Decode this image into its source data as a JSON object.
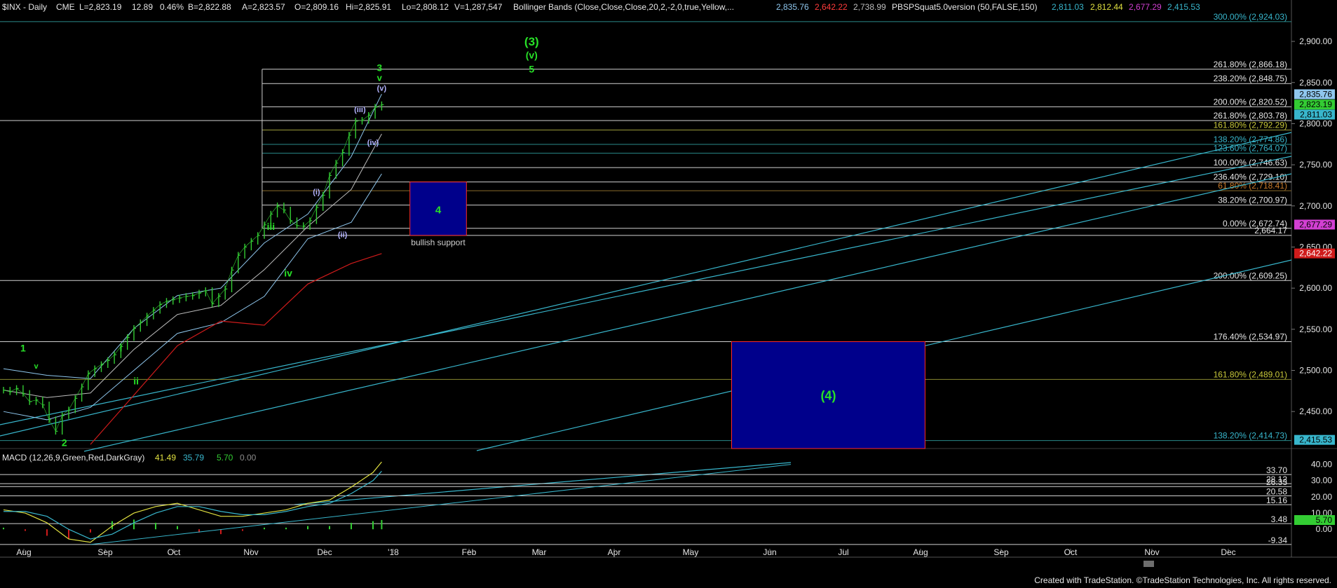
{
  "header": {
    "symbol": "$INX - Daily",
    "exchange": "CME",
    "last": "L=2,823.19",
    "change": "12.89",
    "change_pct": "0.46%",
    "bid": "B=2,822.88",
    "ask": "A=2,823.57",
    "open": "O=2,809.16",
    "high": "Hi=2,825.91",
    "low": "Lo=2,808.12",
    "volume": "V=1,287,547",
    "bb_label": "Bollinger Bands (Close,Close,Close,20,2,-2,0,true,Yellow,...",
    "bb_v1": "2,835.76",
    "bb_v2": "2,642.22",
    "bb_v3": "2,738.99",
    "pbs_label": "PBSPSquat5.0version (50,FALSE,150)",
    "pbs_v1": "2,811.03",
    "pbs_v2": "2,812.44",
    "pbs_v3": "2,677.29",
    "pbs_v4": "2,415.53"
  },
  "colors": {
    "background": "#000000",
    "price_bars": "#33cc33",
    "bb_band": "#8fc7ee",
    "midline": "#bdbdbd",
    "red_line": "#d01b1b",
    "trend": "#38b6cc",
    "wave_label": "#27e027",
    "subwave_label": "#b3b3ff",
    "box_fill": "#00008b",
    "box_border": "#ff2a2a"
  },
  "chart_data": {
    "type": "line",
    "title": "$INX - Daily",
    "x_months": [
      "Aug",
      "Sep",
      "Oct",
      "Nov",
      "Dec",
      "'18",
      "Feb",
      "Mar",
      "Apr",
      "May",
      "Jun",
      "Jul",
      "Aug",
      "Sep",
      "Oct",
      "Nov",
      "Dec"
    ],
    "price_axis": {
      "ylim": [
        2405,
        2935
      ],
      "ticks": [
        "2,900.00",
        "2,850.00",
        "2,800.00",
        "2,750.00",
        "2,700.00",
        "2,650.00",
        "2,600.00",
        "2,550.00",
        "2,500.00",
        "2,450.00"
      ]
    },
    "price_series": {
      "name": "$INX",
      "day_index": [
        0,
        3,
        6,
        9,
        12,
        15,
        18,
        21,
        24,
        27,
        30,
        33,
        36,
        39,
        42,
        45,
        48,
        51,
        54,
        57,
        60,
        63,
        66,
        69,
        72,
        75,
        78,
        81,
        84,
        87,
        90,
        93,
        96,
        99,
        102,
        105,
        108,
        111,
        114,
        117,
        120,
        123,
        126,
        129,
        132,
        135,
        138,
        141,
        144,
        147,
        150,
        153,
        156,
        159,
        162,
        165,
        168,
        171,
        174
      ],
      "close": [
        2476,
        2474,
        2478,
        2472,
        2462,
        2464,
        2458,
        2440,
        2426,
        2445,
        2452,
        2466,
        2480,
        2496,
        2502,
        2507,
        2512,
        2519,
        2529,
        2540,
        2551,
        2558,
        2566,
        2573,
        2580,
        2584,
        2586,
        2588,
        2590,
        2591,
        2594,
        2597,
        2581,
        2590,
        2599,
        2622,
        2640,
        2650,
        2657,
        2664,
        2677,
        2690,
        2700,
        2695,
        2682,
        2676,
        2675,
        2682,
        2698,
        2713,
        2737,
        2752,
        2765,
        2786,
        2803,
        2804,
        2810,
        2820,
        2823
      ]
    },
    "bollinger_upper": {
      "day_index": [
        0,
        20,
        40,
        60,
        80,
        100,
        120,
        140,
        160,
        174
      ],
      "value": [
        2502,
        2494,
        2490,
        2551,
        2591,
        2600,
        2655,
        2690,
        2760,
        2836
      ]
    },
    "bollinger_lower": {
      "day_index": [
        0,
        20,
        40,
        60,
        80,
        100,
        120,
        140,
        160,
        174
      ],
      "value": [
        2450,
        2440,
        2455,
        2500,
        2545,
        2558,
        2590,
        2660,
        2680,
        2739
      ]
    },
    "red_line": {
      "day_index": [
        40,
        60,
        80,
        100,
        120,
        140,
        160,
        174
      ],
      "value": [
        2410,
        2470,
        2530,
        2560,
        2555,
        2605,
        2630,
        2642
      ]
    },
    "fib_levels": [
      {
        "label": "300.00% (2,924.03)",
        "value": 2924.03
      },
      {
        "label": "261.80% (2,866.18)",
        "value": 2866.18
      },
      {
        "label": "238.20% (2,848.75)",
        "value": 2848.75
      },
      {
        "label": "200.00% (2,820.52)",
        "value": 2820.52
      },
      {
        "label": "261.80% (2,803.78)",
        "value": 2803.78
      },
      {
        "label": "161.80% (2,792.29)",
        "value": 2792.29
      },
      {
        "label": "138.20% (2,774.86)",
        "value": 2774.86
      },
      {
        "label": "123.60% (2,764.07)",
        "value": 2764.07
      },
      {
        "label": "100.00% (2,746.63)",
        "value": 2746.63
      },
      {
        "label": "236.40% (2,729.10)",
        "value": 2729.1
      },
      {
        "label": "61.80% (2,718.41)",
        "value": 2718.41
      },
      {
        "label": "38.20% (2,700.97)",
        "value": 2700.97
      },
      {
        "label": "0.00% (2,672.74)",
        "value": 2672.74
      },
      {
        "label": "2,664.17",
        "value": 2664.17
      },
      {
        "label": "200.00% (2,609.25)",
        "value": 2609.25
      },
      {
        "label": "176.40% (2,534.97)",
        "value": 2534.97
      },
      {
        "label": "161.80% (2,489.01)",
        "value": 2489.01
      },
      {
        "label": "138.20% (2,414.73)",
        "value": 2414.73
      }
    ],
    "price_tags": [
      {
        "text": "2,835.76",
        "value": 2835.76,
        "bg": "#8fc7ee",
        "fg": "#000000"
      },
      {
        "text": "2,823.19",
        "value": 2823.19,
        "bg": "#33cc33",
        "fg": "#000000"
      },
      {
        "text": "2,811.03",
        "value": 2811.03,
        "bg": "#38b6cc",
        "fg": "#000000"
      },
      {
        "text": "2,677.29",
        "value": 2677.29,
        "bg": "#d23fd2",
        "fg": "#000000"
      },
      {
        "text": "2,642.22",
        "value": 2642.22,
        "bg": "#d01b1b",
        "fg": "#ffffff"
      },
      {
        "text": "2,415.53",
        "value": 2415.53,
        "bg": "#38b6cc",
        "fg": "#000000"
      }
    ],
    "wave_labels": [
      {
        "text": "(3)",
        "day": 243,
        "value": 2895,
        "color": "green",
        "size": 17
      },
      {
        "text": "(v)",
        "day": 243,
        "value": 2879,
        "color": "green",
        "size": 14
      },
      {
        "text": "5",
        "day": 243,
        "value": 2862,
        "color": "green",
        "size": 14
      },
      {
        "text": "3",
        "day": 173,
        "value": 2864,
        "color": "green",
        "size": 14
      },
      {
        "text": "v",
        "day": 173,
        "value": 2852,
        "color": "green",
        "size": 13
      },
      {
        "text": "(v)",
        "day": 174,
        "value": 2840,
        "color": "sub",
        "size": 11
      },
      {
        "text": "(iii)",
        "day": 164,
        "value": 2814,
        "color": "sub",
        "size": 11
      },
      {
        "text": "(iv)",
        "day": 170,
        "value": 2774,
        "color": "sub",
        "size": 11
      },
      {
        "text": "(i)",
        "day": 144,
        "value": 2714,
        "color": "sub",
        "size": 11
      },
      {
        "text": "(ii)",
        "day": 156,
        "value": 2662,
        "color": "sub",
        "size": 11
      },
      {
        "text": "iii",
        "day": 123,
        "value": 2671,
        "color": "green",
        "size": 14
      },
      {
        "text": "iv",
        "day": 131,
        "value": 2614,
        "color": "green",
        "size": 14
      },
      {
        "text": "1",
        "day": 9,
        "value": 2523,
        "color": "green",
        "size": 14
      },
      {
        "text": "v",
        "day": 15,
        "value": 2502,
        "color": "green",
        "size": 11
      },
      {
        "text": "i",
        "day": 54,
        "value": 2523,
        "color": "green",
        "size": 14
      },
      {
        "text": "ii",
        "day": 61,
        "value": 2483,
        "color": "green",
        "size": 14
      },
      {
        "text": "2",
        "day": 28,
        "value": 2408,
        "color": "green",
        "size": 14
      }
    ],
    "target_boxes": [
      {
        "label": "4",
        "caption": "bullish support",
        "day_start": 187,
        "day_end": 213,
        "top": 2729.1,
        "bottom": 2664.17
      },
      {
        "label": "(4)",
        "caption": "",
        "day_start": 335,
        "day_end": 424,
        "top": 2534.97,
        "bottom": 2405
      }
    ],
    "macd": {
      "label": "MACD (12,26,9,Green,Red,DarkGray)",
      "values_text": [
        "41.49",
        "35.79",
        "5.70",
        "0.00"
      ],
      "ylim": [
        -12,
        45
      ],
      "ticks": [
        "40.00",
        "30.00",
        "20.00",
        "10.00",
        "0.00"
      ],
      "levels": [
        {
          "label": "33.70",
          "value": 33.7
        },
        {
          "label": "28.12",
          "value": 28.12
        },
        {
          "label": "26.33",
          "value": 26.33
        },
        {
          "label": "20.58",
          "value": 20.58
        },
        {
          "label": "15.16",
          "value": 15.16
        },
        {
          "label": "3.48",
          "value": 3.48
        },
        {
          "label": "-9.34",
          "value": -9.34
        }
      ],
      "tags": [
        {
          "text": "5.70",
          "value": 5.7,
          "bg": "#33cc33",
          "fg": "#000000"
        }
      ],
      "macd_line": {
        "day_index": [
          0,
          10,
          20,
          30,
          40,
          50,
          60,
          70,
          80,
          90,
          100,
          110,
          120,
          130,
          140,
          150,
          160,
          170,
          174
        ],
        "value": [
          12,
          10,
          4,
          -6,
          -8,
          2,
          10,
          14,
          16,
          12,
          8,
          8,
          10,
          12,
          16,
          18,
          26,
          35,
          41.49
        ]
      },
      "signal_line": {
        "day_index": [
          0,
          10,
          20,
          30,
          40,
          50,
          60,
          70,
          80,
          90,
          100,
          110,
          120,
          130,
          140,
          150,
          160,
          170,
          174
        ],
        "value": [
          11,
          11,
          8,
          0,
          -6,
          -3,
          4,
          10,
          14,
          14,
          11,
          9,
          9,
          11,
          14,
          16,
          22,
          30,
          35.79
        ]
      }
    }
  },
  "footer": {
    "text": "Created with TradeStation. ©TradeStation Technologies, Inc. All rights reserved."
  }
}
